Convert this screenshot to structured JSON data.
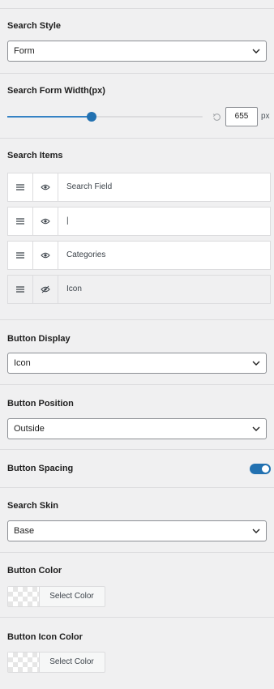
{
  "search_style": {
    "label": "Search Style",
    "value": "Form"
  },
  "form_width": {
    "label": "Search Form Width(px)",
    "value": "655",
    "unit": "px",
    "slider_fraction": 0.43
  },
  "search_items": {
    "label": "Search Items",
    "items": [
      {
        "text": "Search Field",
        "visible": true
      },
      {
        "text": "|",
        "visible": true
      },
      {
        "text": "Categories",
        "visible": true
      },
      {
        "text": "Icon",
        "visible": false
      }
    ]
  },
  "button_display": {
    "label": "Button Display",
    "value": "Icon"
  },
  "button_position": {
    "label": "Button Position",
    "value": "Outside"
  },
  "button_spacing": {
    "label": "Button Spacing",
    "enabled": true
  },
  "search_skin": {
    "label": "Search Skin",
    "value": "Base"
  },
  "button_color": {
    "label": "Button Color",
    "picker_text": "Select Color"
  },
  "button_icon_color": {
    "label": "Button Icon Color",
    "picker_text": "Select Color"
  },
  "colors": {
    "accent": "#2271b1",
    "border": "#dcdcde",
    "background": "#f0f0f1"
  },
  "icons": [
    "chevron-down-icon",
    "reset-icon",
    "drag-handle-icon",
    "eye-icon",
    "eye-hidden-icon"
  ]
}
